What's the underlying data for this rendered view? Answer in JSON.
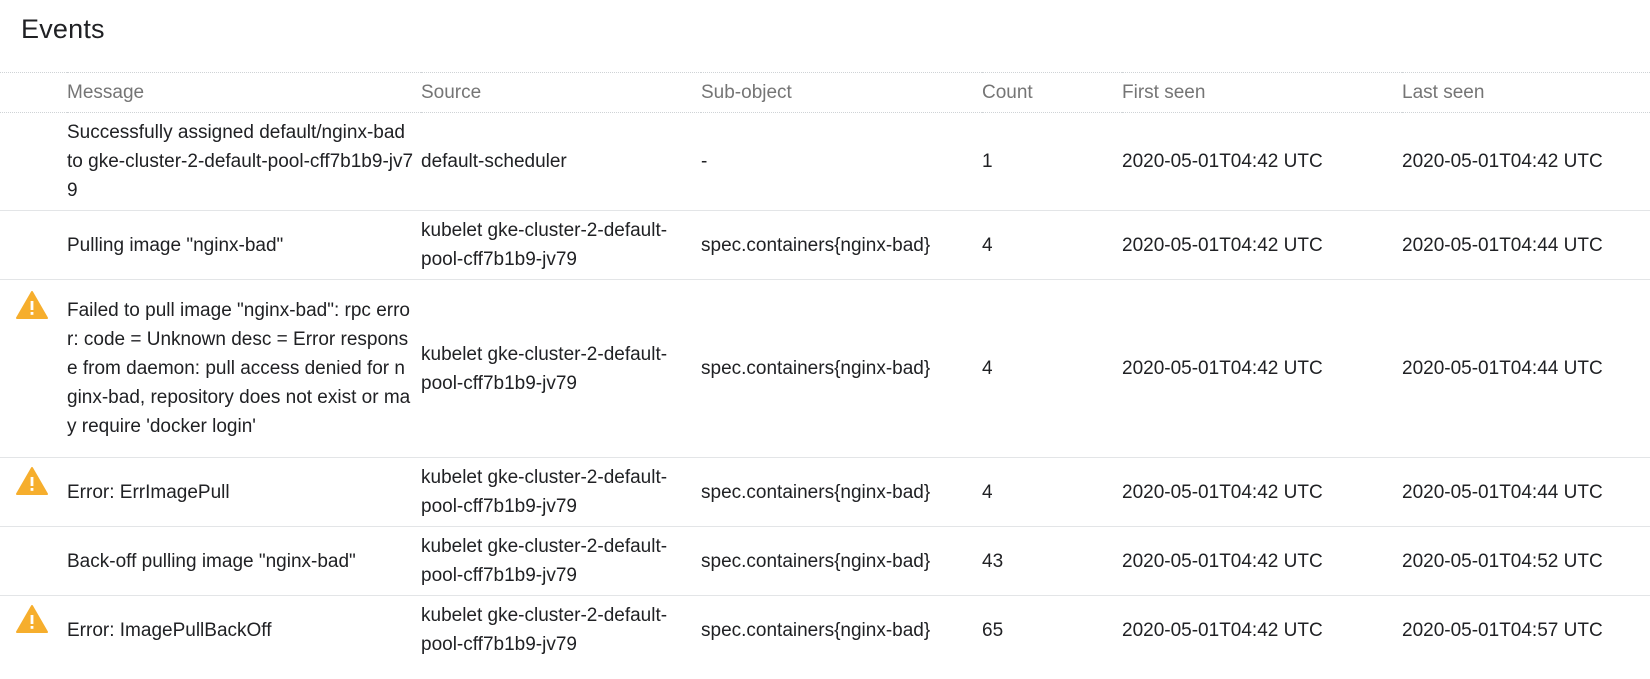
{
  "panel": {
    "title": "Events"
  },
  "columns": {
    "message": "Message",
    "source": "Source",
    "sub_object": "Sub-object",
    "count": "Count",
    "first_seen": "First seen",
    "last_seen": "Last seen"
  },
  "colors": {
    "warning": "#f6ae2d",
    "header_text": "#757575",
    "text": "#202124"
  },
  "icons": {
    "warning": "warning-icon"
  },
  "events": [
    {
      "warning": false,
      "message": "Successfully assigned default/nginx-bad to gke-cluster-2-default-pool-cff7b1b9-jv79",
      "source": "default-scheduler",
      "sub_object": "-",
      "count": "1",
      "first_seen": "2020-05-01T04:42 UTC",
      "last_seen": "2020-05-01T04:42 UTC"
    },
    {
      "warning": false,
      "message": "Pulling image \"nginx-bad\"",
      "source": "kubelet gke-cluster-2-default-pool-cff7b1b9-jv79",
      "sub_object": "spec.containers{nginx-bad}",
      "count": "4",
      "first_seen": "2020-05-01T04:42 UTC",
      "last_seen": "2020-05-01T04:44 UTC"
    },
    {
      "warning": true,
      "message": "Failed to pull image \"nginx-bad\": rpc error: code = Unknown desc = Error response from daemon: pull access denied for nginx-bad, repository does not exist or may require 'docker login'",
      "source": "kubelet gke-cluster-2-default-pool-cff7b1b9-jv79",
      "sub_object": "spec.containers{nginx-bad}",
      "count": "4",
      "first_seen": "2020-05-01T04:42 UTC",
      "last_seen": "2020-05-01T04:44 UTC"
    },
    {
      "warning": true,
      "message": "Error: ErrImagePull",
      "source": "kubelet gke-cluster-2-default-pool-cff7b1b9-jv79",
      "sub_object": "spec.containers{nginx-bad}",
      "count": "4",
      "first_seen": "2020-05-01T04:42 UTC",
      "last_seen": "2020-05-01T04:44 UTC"
    },
    {
      "warning": false,
      "message": "Back-off pulling image \"nginx-bad\"",
      "source": "kubelet gke-cluster-2-default-pool-cff7b1b9-jv79",
      "sub_object": "spec.containers{nginx-bad}",
      "count": "43",
      "first_seen": "2020-05-01T04:42 UTC",
      "last_seen": "2020-05-01T04:52 UTC"
    },
    {
      "warning": true,
      "message": "Error: ImagePullBackOff",
      "source": "kubelet gke-cluster-2-default-pool-cff7b1b9-jv79",
      "sub_object": "spec.containers{nginx-bad}",
      "count": "65",
      "first_seen": "2020-05-01T04:42 UTC",
      "last_seen": "2020-05-01T04:57 UTC"
    }
  ]
}
